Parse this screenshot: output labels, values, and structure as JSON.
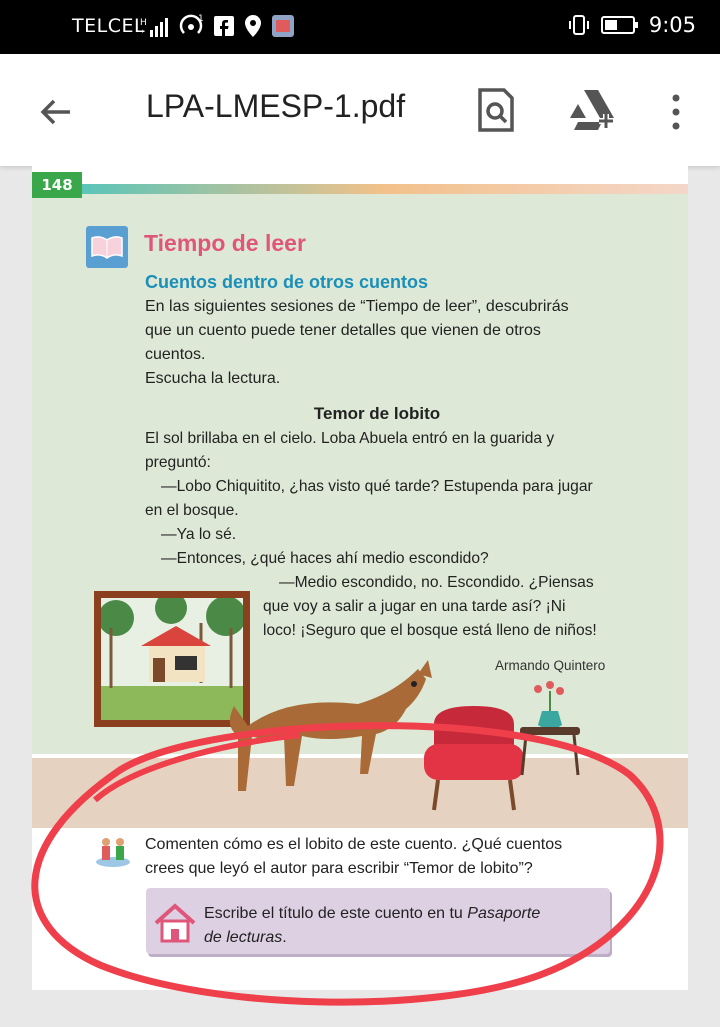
{
  "status_bar": {
    "carrier": "TELCEL",
    "network_badge": "1",
    "time": "9:05"
  },
  "app_bar": {
    "title": "LPA-LMESP-1.pdf"
  },
  "page": {
    "page_number": "148",
    "section_title": "Tiempo de leer",
    "subtitle": "Cuentos dentro de otros cuentos",
    "intro_lines": [
      "En las siguientes sesiones de “Tiempo de leer”, descubrirás",
      "que un cuento puede tener detalles que vienen de otros",
      "cuentos.",
      "Escucha la lectura."
    ],
    "story_title": "Temor de lobito",
    "story_lines": [
      "El sol brillaba en el cielo. Loba Abuela entró en la guarida y",
      "preguntó:",
      "—Lobo Chiquitito, ¿has visto qué tarde? Estupenda para jugar",
      "en el bosque.",
      "—Ya lo sé.",
      "—Entonces, ¿qué haces ahí medio escondido?",
      "—Medio escondido, no. Escondido. ¿Piensas",
      "que voy a salir a jugar en una tarde así? ¡Ni",
      "loco! ¡Seguro que el bosque está lleno de niños!"
    ],
    "author": "Armando Quintero",
    "question_lines": [
      "Comenten cómo es el lobito de este cuento. ¿Qué cuentos",
      "crees que leyó el autor para escribir “Temor de lobito”?"
    ],
    "callout_line1": "Escribe el título de este cuento en tu ",
    "callout_italic": "Pasaporte",
    "callout_line2_italic": "de lecturas",
    "callout_line2_end": "."
  },
  "colors": {
    "accent_pink": "#e0567a",
    "accent_blue": "#1c8fb9",
    "page_green": "#3aa74a",
    "annotation_red": "#ee3f4a"
  }
}
